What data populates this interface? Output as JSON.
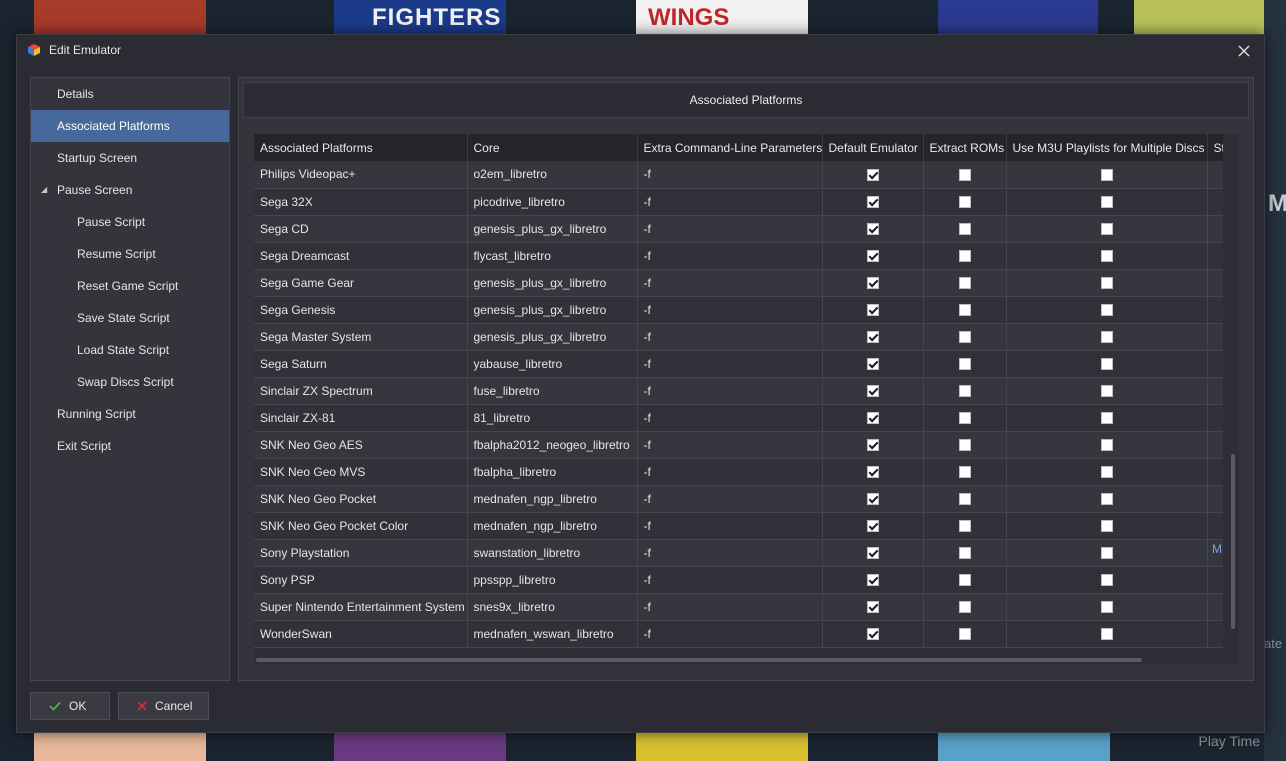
{
  "background": {
    "tile_text": [
      "FIGHTERS",
      "WINGS"
    ],
    "fragment_text": [
      "M",
      "M",
      "ate"
    ],
    "play_time_label": "Play Time"
  },
  "dialog": {
    "title": "Edit Emulator",
    "close_icon": "close-icon",
    "sidebar": {
      "items": [
        {
          "label": "Details"
        },
        {
          "label": "Associated Platforms"
        },
        {
          "label": "Startup Screen"
        },
        {
          "label": "Pause Screen"
        },
        {
          "label": "Pause Script"
        },
        {
          "label": "Resume Script"
        },
        {
          "label": "Reset Game Script"
        },
        {
          "label": "Save State Script"
        },
        {
          "label": "Load State Script"
        },
        {
          "label": "Swap Discs Script"
        },
        {
          "label": "Running Script"
        },
        {
          "label": "Exit Script"
        }
      ],
      "active_index": 1
    },
    "panel": {
      "header": "Associated Platforms",
      "columns": [
        "Associated Platforms",
        "Core",
        "Extra Command-Line Parameters",
        "Default Emulator",
        "Extract ROMs",
        "Use M3U Playlists for Multiple Discs",
        "St"
      ],
      "rows": [
        {
          "platform": "Philips Videopac+",
          "core": "o2em_libretro",
          "params": "-f",
          "default": true,
          "extract": false,
          "m3u": false
        },
        {
          "platform": "Sega 32X",
          "core": "picodrive_libretro",
          "params": "-f",
          "default": true,
          "extract": false,
          "m3u": false
        },
        {
          "platform": "Sega CD",
          "core": "genesis_plus_gx_libretro",
          "params": "-f",
          "default": true,
          "extract": false,
          "m3u": false
        },
        {
          "platform": "Sega Dreamcast",
          "core": "flycast_libretro",
          "params": "-f",
          "default": true,
          "extract": false,
          "m3u": false
        },
        {
          "platform": "Sega Game Gear",
          "core": "genesis_plus_gx_libretro",
          "params": "-f",
          "default": true,
          "extract": false,
          "m3u": false
        },
        {
          "platform": "Sega Genesis",
          "core": "genesis_plus_gx_libretro",
          "params": "-f",
          "default": true,
          "extract": false,
          "m3u": false
        },
        {
          "platform": "Sega Master System",
          "core": "genesis_plus_gx_libretro",
          "params": "-f",
          "default": true,
          "extract": false,
          "m3u": false
        },
        {
          "platform": "Sega Saturn",
          "core": "yabause_libretro",
          "params": "-f",
          "default": true,
          "extract": false,
          "m3u": false
        },
        {
          "platform": "Sinclair ZX Spectrum",
          "core": "fuse_libretro",
          "params": "-f",
          "default": true,
          "extract": false,
          "m3u": false
        },
        {
          "platform": "Sinclair ZX-81",
          "core": "81_libretro",
          "params": "-f",
          "default": true,
          "extract": false,
          "m3u": false
        },
        {
          "platform": "SNK Neo Geo AES",
          "core": "fbalpha2012_neogeo_libretro",
          "params": "-f",
          "default": true,
          "extract": false,
          "m3u": false
        },
        {
          "platform": "SNK Neo Geo MVS",
          "core": "fbalpha_libretro",
          "params": "-f",
          "default": true,
          "extract": false,
          "m3u": false
        },
        {
          "platform": "SNK Neo Geo Pocket",
          "core": "mednafen_ngp_libretro",
          "params": "-f",
          "default": true,
          "extract": false,
          "m3u": false
        },
        {
          "platform": "SNK Neo Geo Pocket Color",
          "core": "mednafen_ngp_libretro",
          "params": "-f",
          "default": true,
          "extract": false,
          "m3u": false
        },
        {
          "platform": "Sony Playstation",
          "core": "swanstation_libretro",
          "params": "-f",
          "default": true,
          "extract": false,
          "m3u": false
        },
        {
          "platform": "Sony PSP",
          "core": "ppsspp_libretro",
          "params": "-f",
          "default": true,
          "extract": false,
          "m3u": false
        },
        {
          "platform": "Super Nintendo Entertainment System",
          "core": "snes9x_libretro",
          "params": "-f",
          "default": true,
          "extract": false,
          "m3u": false
        },
        {
          "platform": "WonderSwan",
          "core": "mednafen_wswan_libretro",
          "params": "-f",
          "default": true,
          "extract": false,
          "m3u": false
        }
      ],
      "overflow_mark": "M"
    },
    "buttons": {
      "ok_label": "OK",
      "cancel_label": "Cancel"
    },
    "colors": {
      "active_nav": "#46689a",
      "ok_icon": "#4caf50",
      "cancel_icon": "#d03030"
    }
  }
}
